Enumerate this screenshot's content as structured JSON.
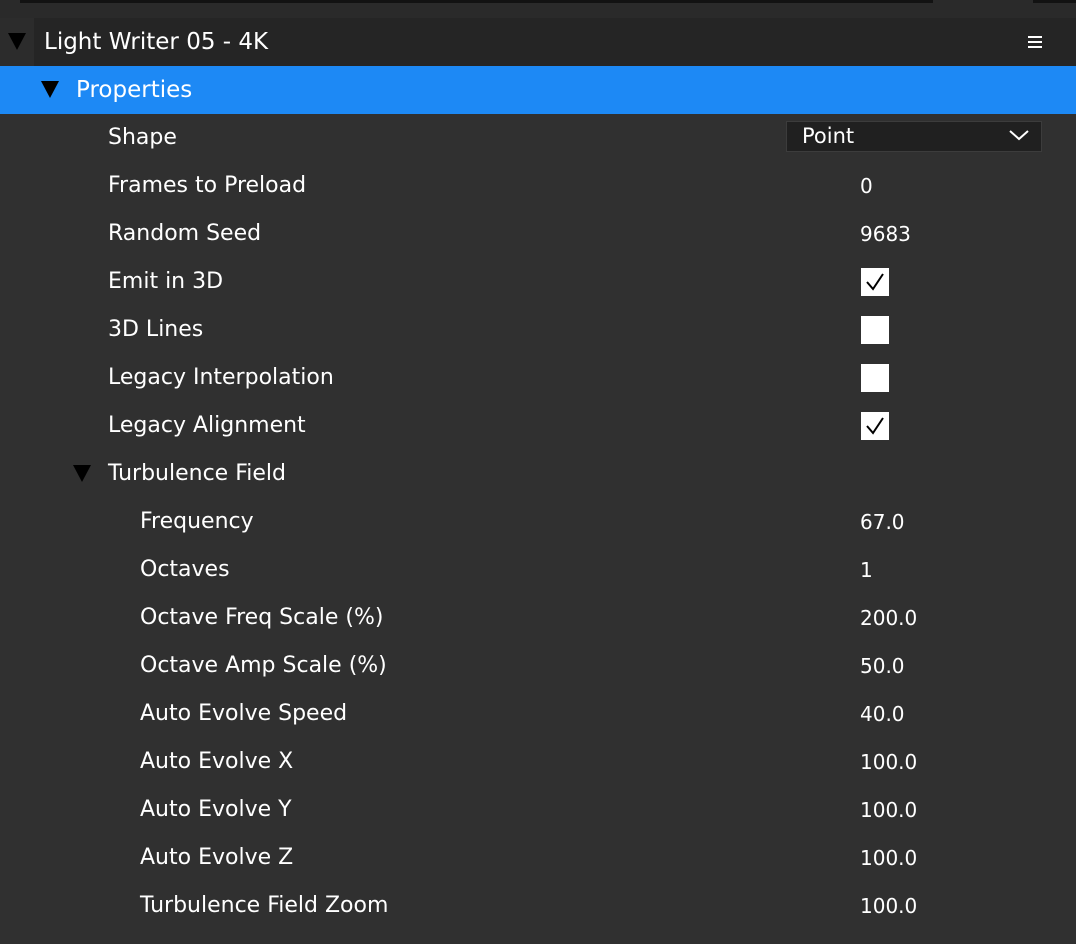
{
  "panel": {
    "title": "Light Writer 05 - 4K",
    "menu_icon": "hamburger-menu-icon"
  },
  "section": {
    "title": "Properties"
  },
  "properties": {
    "shape": {
      "label": "Shape",
      "value": "Point"
    },
    "frames_to_preload": {
      "label": "Frames to Preload",
      "value": "0"
    },
    "random_seed": {
      "label": "Random Seed",
      "value": "9683"
    },
    "emit_in_3d": {
      "label": "Emit in 3D",
      "checked": true
    },
    "lines_3d": {
      "label": "3D Lines",
      "checked": false
    },
    "legacy_interpolation": {
      "label": "Legacy Interpolation",
      "checked": false
    },
    "legacy_alignment": {
      "label": "Legacy Alignment",
      "checked": true
    }
  },
  "turbulence_field": {
    "title": "Turbulence Field",
    "rows": [
      {
        "label": "Frequency",
        "value": "67.0"
      },
      {
        "label": "Octaves",
        "value": "1"
      },
      {
        "label": "Octave Freq Scale (%)",
        "value": "200.0"
      },
      {
        "label": "Octave Amp Scale (%)",
        "value": "50.0"
      },
      {
        "label": "Auto Evolve Speed",
        "value": "40.0"
      },
      {
        "label": "Auto Evolve X",
        "value": "100.0"
      },
      {
        "label": "Auto Evolve Y",
        "value": "100.0"
      },
      {
        "label": "Auto Evolve Z",
        "value": "100.0"
      },
      {
        "label": "Turbulence Field Zoom",
        "value": "100.0"
      }
    ]
  },
  "colors": {
    "background": "#303030",
    "header": "#252525",
    "accent": "#1d89f5",
    "text": "#ffffff"
  }
}
